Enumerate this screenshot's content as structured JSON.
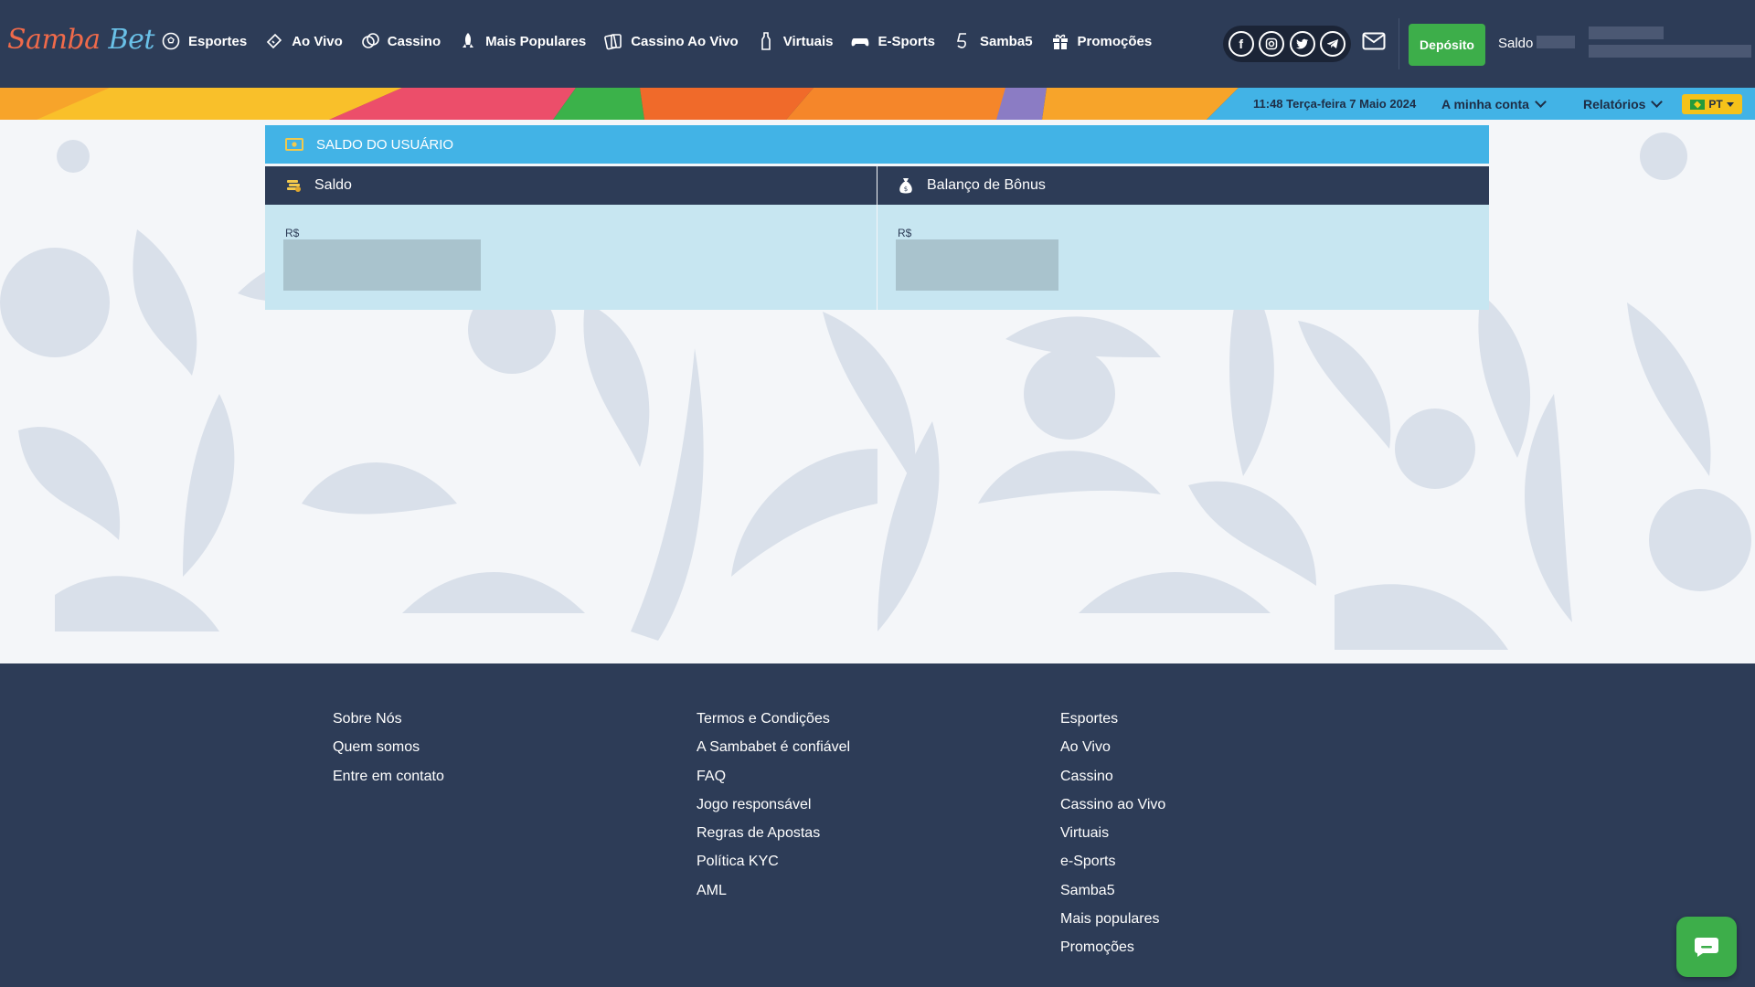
{
  "brand": {
    "logo_part1": "Samba",
    "logo_part2": " ",
    "logo_part3": "Bet"
  },
  "nav": [
    {
      "label": "Esportes",
      "icon": "soccer-ball-icon"
    },
    {
      "label": "Ao Vivo",
      "icon": "ticket-icon"
    },
    {
      "label": "Cassino",
      "icon": "chips-icon"
    },
    {
      "label": "Mais Populares",
      "icon": "rocket-icon"
    },
    {
      "label": "Cassino Ao Vivo",
      "icon": "cards-icon"
    },
    {
      "label": "Virtuais",
      "icon": "bottle-icon"
    },
    {
      "label": "E-Sports",
      "icon": "gamepad-icon"
    },
    {
      "label": "Samba5",
      "icon": "samba5-icon"
    },
    {
      "label": "Promoções",
      "icon": "gift-icon"
    }
  ],
  "social": [
    "facebook-icon",
    "instagram-icon",
    "twitter-icon",
    "telegram-icon"
  ],
  "header": {
    "deposit_label": "Depósito",
    "balance_label": "Saldo"
  },
  "strip": {
    "datetime": "11:48 Terça-feira 7 Maio 2024",
    "my_account": "A minha conta",
    "reports": "Relatórios",
    "language": "PT"
  },
  "balance_panel": {
    "title": "SALDO DO USUÁRIO",
    "balance_title": "Saldo",
    "bonus_title": "Balanço de Bônus",
    "currency": "R$",
    "bonus_currency": "R$"
  },
  "footer": {
    "col1": [
      "Sobre Nós",
      "Quem somos",
      "Entre em contato"
    ],
    "col2": [
      "Termos e Condições",
      "A Sambabet é confiável",
      "FAQ",
      "Jogo responsável",
      "Regras de Apostas",
      "Política KYC",
      "AML"
    ],
    "col3": [
      "Esportes",
      "Ao Vivo",
      "Cassino",
      "Cassino ao Vivo",
      "Virtuais",
      "e-Sports",
      "Samba5",
      "Mais populares",
      "Promoções"
    ]
  },
  "colors": {
    "header": "#2d3c57",
    "accent_blue": "#42b3e6",
    "deposit_green": "#3dae4a",
    "panel_body": "#c7e6f1"
  }
}
